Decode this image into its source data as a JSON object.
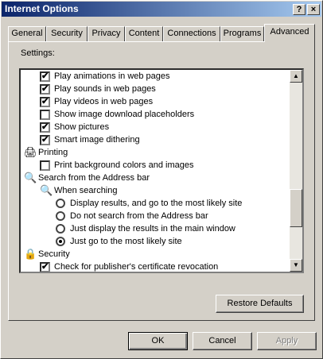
{
  "window": {
    "title": "Internet Options",
    "help_glyph": "?",
    "close_glyph": "×"
  },
  "tabs": [
    "General",
    "Security",
    "Privacy",
    "Content",
    "Connections",
    "Programs",
    "Advanced"
  ],
  "active_tab": "Advanced",
  "settings_label": "Settings:",
  "rows": [
    {
      "kind": "checkbox",
      "checked": true,
      "label": "Play animations in web pages"
    },
    {
      "kind": "checkbox",
      "checked": true,
      "label": "Play sounds in web pages"
    },
    {
      "kind": "checkbox",
      "checked": true,
      "label": "Play videos in web pages"
    },
    {
      "kind": "checkbox",
      "checked": false,
      "label": "Show image download placeholders"
    },
    {
      "kind": "checkbox",
      "checked": true,
      "label": "Show pictures"
    },
    {
      "kind": "checkbox",
      "checked": true,
      "label": "Smart image dithering"
    },
    {
      "kind": "category",
      "icon": "printer-icon",
      "label": "Printing"
    },
    {
      "kind": "checkbox",
      "checked": false,
      "label": "Print background colors and images"
    },
    {
      "kind": "category",
      "icon": "magnifier-icon",
      "label": "Search from the Address bar"
    },
    {
      "kind": "subcategory",
      "icon": "magnifier-icon",
      "label": "When searching"
    },
    {
      "kind": "radio",
      "selected": false,
      "label": "Display results, and go to the most likely site"
    },
    {
      "kind": "radio",
      "selected": false,
      "label": "Do not search from the Address bar"
    },
    {
      "kind": "radio",
      "selected": false,
      "label": "Just display the results in the main window"
    },
    {
      "kind": "radio",
      "selected": true,
      "label": "Just go to the most likely site"
    },
    {
      "kind": "category",
      "icon": "lock-icon",
      "label": "Security"
    },
    {
      "kind": "checkbox",
      "checked": true,
      "label": "Check for publisher's certificate revocation"
    }
  ],
  "restore_defaults_label": "Restore Defaults",
  "buttons": {
    "ok": "OK",
    "cancel": "Cancel",
    "apply": "Apply"
  }
}
